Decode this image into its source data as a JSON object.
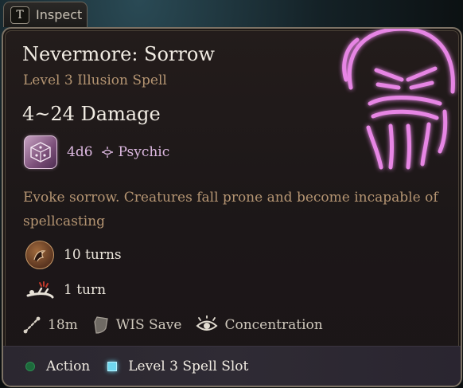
{
  "tab": {
    "key": "T",
    "label": "Inspect"
  },
  "spell": {
    "title": "Nevermore: Sorrow",
    "subtitle": "Level 3 Illusion Spell",
    "damage": "4~24 Damage",
    "dice": "4d6",
    "damage_type": "Psychic",
    "description": "Evoke sorrow. Creatures fall prone and become incapable of spellcasting"
  },
  "effects": [
    {
      "icon": "raven-portrait-icon",
      "text": "10 turns"
    },
    {
      "icon": "prone-figure-icon",
      "text": "1 turn"
    }
  ],
  "properties": [
    {
      "icon": "range-icon",
      "text": "18m"
    },
    {
      "icon": "shield-icon",
      "text": "WIS Save"
    },
    {
      "icon": "concentration-eye-icon",
      "text": "Concentration"
    }
  ],
  "costs": [
    {
      "icon": "action-dot-icon",
      "text": "Action",
      "color": "#1d6a3b"
    },
    {
      "icon": "spell-slot-icon",
      "text": "Level 3 Spell Slot",
      "color": "#6fd8ef"
    }
  ],
  "colors": {
    "title": "#f1ece3",
    "subtitle": "#b59572",
    "psychic": "#dcb8e0",
    "portrait_glow": "#e77ae0"
  }
}
